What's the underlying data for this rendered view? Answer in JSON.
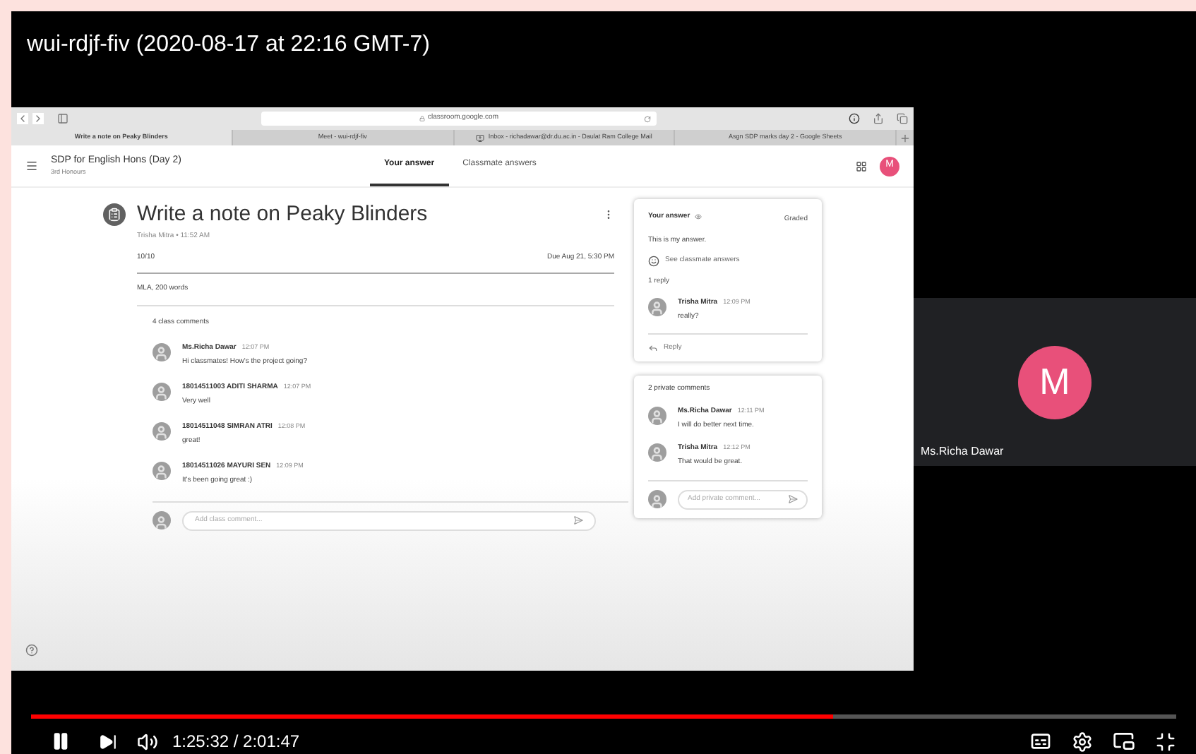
{
  "video_title": "wui-rdjf-fiv (2020-08-17 at 22:16 GMT-7)",
  "browser": {
    "url": "classroom.google.com",
    "tabs": [
      {
        "label": "Write a note on Peaky Blinders",
        "selected": true
      },
      {
        "label": "Meet - wui-rdjf-fiv",
        "selected": false
      },
      {
        "label": "Inbox - richadawar@dr.du.ac.in - Daulat Ram College Mail",
        "selected": false
      },
      {
        "label": "Asgn SDP marks day 2 - Google Sheets",
        "selected": false
      }
    ]
  },
  "classroom": {
    "course": "SDP for English Hons (Day 2)",
    "section": "3rd Honours",
    "tabs": [
      {
        "label": "Your answer",
        "selected": true
      },
      {
        "label": "Classmate answers",
        "selected": false
      }
    ],
    "avatar_letter": "M"
  },
  "assignment": {
    "title": "Write a note on Peaky Blinders",
    "byline": "Trisha Mitra • 11:52 AM",
    "points": "10/10",
    "due": "Due Aug 21, 5:30 PM",
    "description": "MLA, 200 words",
    "comments_count": "4 class comments",
    "comments": [
      {
        "author": "Ms.Richa Dawar",
        "time": "12:07 PM",
        "text": "Hi classmates! How's the project going?"
      },
      {
        "author": "18014511003 ADITI SHARMA",
        "time": "12:07 PM",
        "text": "Very well"
      },
      {
        "author": "18014511048 SIMRAN ATRI",
        "time": "12:08 PM",
        "text": "great!"
      },
      {
        "author": "18014511026 MAYURI SEN",
        "time": "12:09 PM",
        "text": "It's been going great :)"
      }
    ],
    "comment_placeholder": "Add class comment..."
  },
  "answer_card": {
    "title": "Your answer",
    "status": "Graded",
    "answer": "This is my answer.",
    "link": "See classmate answers",
    "reply_count": "1 reply",
    "replies": [
      {
        "author": "Trisha Mitra",
        "time": "12:09 PM",
        "text": "really?"
      }
    ],
    "reply_button": "Reply"
  },
  "private_comments": {
    "title": "2 private comments",
    "comments": [
      {
        "author": "Ms.Richa Dawar",
        "time": "12:11 PM",
        "text": "I will do better next time."
      },
      {
        "author": "Trisha Mitra",
        "time": "12:12 PM",
        "text": "That would be great."
      }
    ],
    "placeholder": "Add private comment..."
  },
  "participant": {
    "initial": "M",
    "name": "Ms.Richa Dawar"
  },
  "player": {
    "playing": true,
    "level": 0.7,
    "time": "1:25:32 / 2:01:47"
  }
}
